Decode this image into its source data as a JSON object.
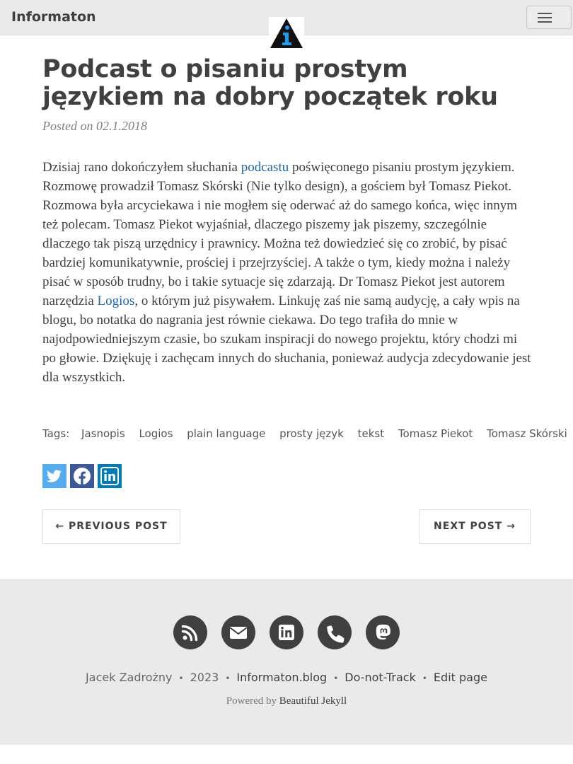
{
  "navbar": {
    "brand": "Informaton"
  },
  "post": {
    "title": "Podcast o pisaniu prostym językiem na dobry początek roku",
    "posted_label": "Posted on",
    "date": "02.1.2018",
    "body": {
      "s1": "Dzisiaj rano dokończyłem słuchania ",
      "link_podcast": "podcastu",
      "s2": " poświęconego pisaniu prostym językiem. Rozmowę prowadził Tomasz Skórski (Nie tylko design), a gościem był Tomasz Piekot. Rozmowa była arcyciekawa i nie mogłem się oderwać aż do samego końca, więc innym też polecam. Tomasz Piekot wyjaśniał, dlaczego piszemy jak piszemy, szczególnie dlaczego tak piszą urzędnicy i prawnicy. Można też dowiedzieć się co zrobić, by pisać bardziej komunikatywnie, prościej i przejrzyściej. A także o tym, kiedy można i należy pisać w sposób trudny, bo i takie sytuacje się zdarzają. Dr Tomasz Piekot jest autorem narzędzia ",
      "link_logios": "Logios",
      "s3": ", o którym już pisywałem. Linkuję zaś nie samą audycję, a cały wpis na blogu, bo notatka do nagrania jest równie ciekawa. Do tego trafiła do mnie w najodpowiedniejszym czasie, bo szukam inspiracji do nowego projektu, który chodzi mi po głowie. Dziękuję i zachęcam innych do słuchania, ponieważ audycja zdecydowanie jest dla wszystkich."
    },
    "tags_label": "Tags:",
    "tags": [
      "Jasnopis",
      "Logios",
      "plain language",
      "prosty język",
      "tekst",
      "Tomasz Piekot",
      "Tomasz Skórski"
    ]
  },
  "share": [
    {
      "icon": "twitter-icon",
      "color": "#55acee"
    },
    {
      "icon": "facebook-icon",
      "color": "#3b5998"
    },
    {
      "icon": "linkedin-icon",
      "color": "#007bb5"
    }
  ],
  "pager": {
    "previous": "← PREVIOUS POST",
    "next": "NEXT POST →"
  },
  "footer": {
    "social_icons": [
      "rss-icon",
      "email-icon",
      "linkedin-icon",
      "phone-icon",
      "mastodon-icon"
    ],
    "author": "Jacek Zadrożny",
    "year": "2023",
    "site": "Informaton.blog",
    "dnt": "Do-not-Track",
    "edit": "Edit page",
    "powered_by": "Powered by",
    "powered_link": "Beautiful Jekyll"
  },
  "colors": {
    "accent_link": "#2067b0",
    "navbar_bg": "#eaeaea",
    "footer_bg": "#eaeaea",
    "icon_dark": "#404040"
  }
}
